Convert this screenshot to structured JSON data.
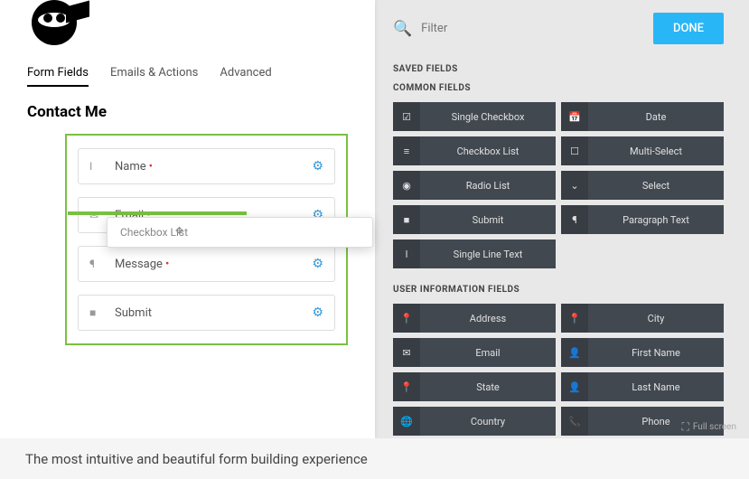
{
  "tabs": [
    "Form Fields",
    "Emails & Actions",
    "Advanced"
  ],
  "form_title": "Contact Me",
  "fields": [
    {
      "icon": "text-icon",
      "glyph": "I",
      "label": "Name",
      "required": true
    },
    {
      "icon": "email-icon",
      "glyph": "✉",
      "label": "Email",
      "required": true
    },
    {
      "icon": "paragraph-icon",
      "glyph": "¶",
      "label": "Message",
      "required": true
    },
    {
      "icon": "submit-icon",
      "glyph": "■",
      "label": "Submit",
      "required": false
    }
  ],
  "dragging": "Checkbox List",
  "filter_placeholder": "Filter",
  "done": "DONE",
  "sections": {
    "saved": "SAVED FIELDS",
    "common": "COMMON FIELDS",
    "user": "USER INFORMATION FIELDS"
  },
  "common_fields": [
    {
      "icon": "☑",
      "label": "Single Checkbox"
    },
    {
      "icon": "📅",
      "label": "Date"
    },
    {
      "icon": "≡",
      "label": "Checkbox List"
    },
    {
      "icon": "☐",
      "label": "Multi-Select"
    },
    {
      "icon": "◉",
      "label": "Radio List"
    },
    {
      "icon": "⌄",
      "label": "Select"
    },
    {
      "icon": "■",
      "label": "Submit"
    },
    {
      "icon": "¶",
      "label": "Paragraph Text"
    },
    {
      "icon": "I",
      "label": "Single Line Text"
    }
  ],
  "user_fields": [
    {
      "icon": "📍",
      "label": "Address"
    },
    {
      "icon": "📍",
      "label": "City"
    },
    {
      "icon": "✉",
      "label": "Email"
    },
    {
      "icon": "👤",
      "label": "First Name"
    },
    {
      "icon": "📍",
      "label": "State"
    },
    {
      "icon": "👤",
      "label": "Last Name"
    },
    {
      "icon": "🌐",
      "label": "Country"
    },
    {
      "icon": "📞",
      "label": "Phone"
    }
  ],
  "fullscreen": "Full screen",
  "caption": "The most intuitive and beautiful form building experience"
}
